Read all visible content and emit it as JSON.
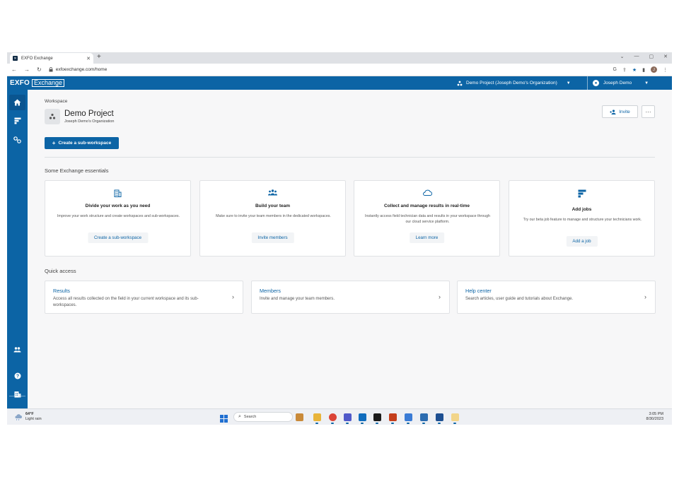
{
  "browser": {
    "tab_title": "EXFO Exchange",
    "url": "exfoexchange.com/home",
    "profile_initial": "J"
  },
  "header": {
    "logo_primary": "EXFO",
    "logo_secondary": "Exchange",
    "project_selector": "Demo Project (Joseph Demo's Organization)",
    "user_name": "Joseph Demo"
  },
  "workspace": {
    "label": "Workspace",
    "name": "Demo Project",
    "organization": "Joseph Demo's Organization",
    "invite_label": "Invite",
    "more_label": "···",
    "create_sub_label": "Create a sub-workspace"
  },
  "essentials": {
    "title": "Some Exchange essentials",
    "cards": [
      {
        "title": "Divide your work as you need",
        "description": "Improve your work structure and create workspaces and sub-workspaces.",
        "action": "Create a sub-workspace",
        "icon": "building-icon"
      },
      {
        "title": "Build your team",
        "description": "Make sure to invite your team members in the dedicated workspaces.",
        "action": "Invite members",
        "icon": "team-icon"
      },
      {
        "title": "Collect and manage results in real-time",
        "description": "Instantly access field technician data and results in your workspace through our cloud service platform.",
        "action": "Learn more",
        "icon": "cloud-icon"
      },
      {
        "title": "Add jobs",
        "description": "Try our beta job feature to manage and structure your technicians work.",
        "action": "Add a job",
        "icon": "jobs-icon"
      }
    ]
  },
  "quick_access": {
    "title": "Quick access",
    "items": [
      {
        "title": "Results",
        "description": "Access all results collected on the field in your current workspace and its sub-workspaces."
      },
      {
        "title": "Members",
        "description": "Invite and manage your team members."
      },
      {
        "title": "Help center",
        "description": "Search articles, user guide and tutorials about Exchange."
      }
    ]
  },
  "taskbar": {
    "temperature": "64°F",
    "weather": "Light rain",
    "search_placeholder": "Search",
    "time": "3:05 PM",
    "date": "8/30/2023"
  },
  "colors": {
    "brand": "#0c64a5",
    "background": "#f7f7f8"
  }
}
